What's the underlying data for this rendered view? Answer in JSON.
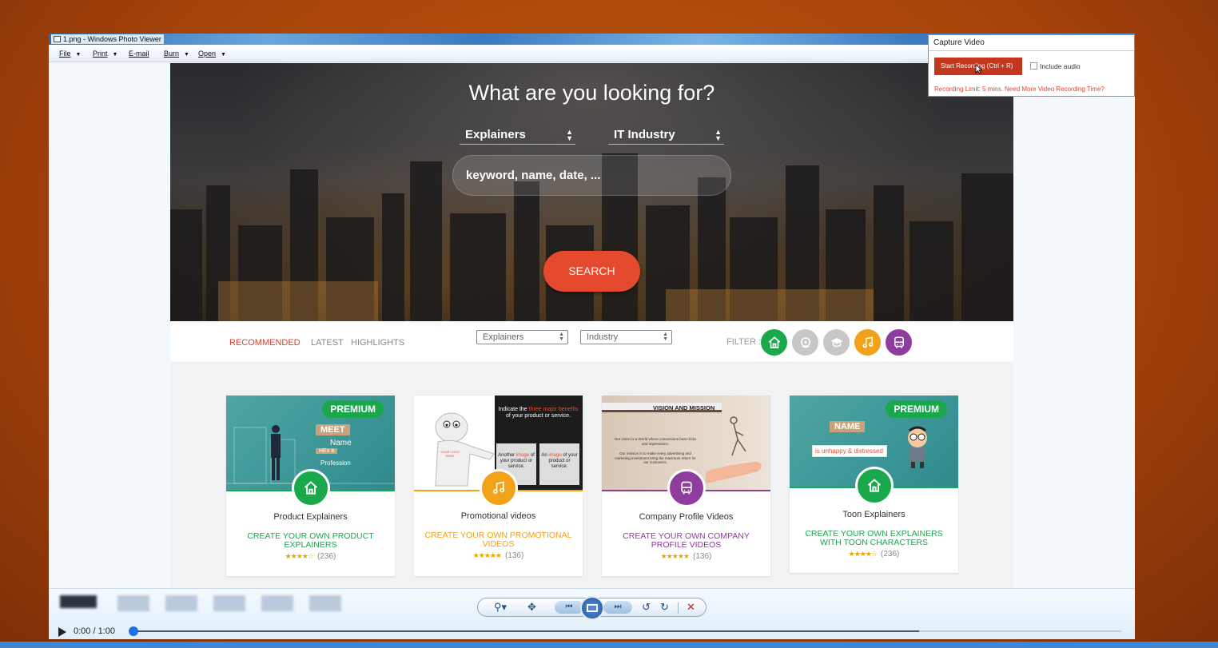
{
  "window": {
    "title": "1.png - Windows Photo Viewer"
  },
  "menu": {
    "file": "File",
    "print": "Print",
    "email": "E-mail",
    "burn": "Burn",
    "open": "Open"
  },
  "hero": {
    "title": "What are you looking for?",
    "select1": "Explainers",
    "select2": "IT Industry",
    "search_placeholder": "keyword, name, date, ...",
    "search_button": "SEARCH"
  },
  "filter": {
    "tabs": [
      "RECOMMENDED",
      "LATEST",
      "HIGHLIGHTS"
    ],
    "select1": "Explainers",
    "select2": "Industry",
    "label": "FILTER :",
    "icon_colors": {
      "home": "#1aa84c",
      "video": "#c7c7c7",
      "education": "#c7c7c7",
      "music": "#f2a218",
      "bus": "#8e3d9e"
    }
  },
  "cards": [
    {
      "title": "Product Explainers",
      "cta": "CREATE YOUR OWN PRODUCT EXPLAINERS",
      "cta_color": "#1aa84c",
      "reviews": "(236)",
      "stars": 4,
      "badge": "PREMIUM",
      "thumb": {
        "meet": "MEET",
        "name": "Name",
        "hex": "HEx a",
        "profession": "Profession"
      }
    },
    {
      "title": "Promotional videos",
      "cta": "CREATE YOUR OWN PROMOTIONAL VIDEOS",
      "cta_color": "#f2a218",
      "reviews": "(136)",
      "stars": 5,
      "badge": "",
      "thumb": {
        "indicate_prefix": "Indicate the ",
        "indicate_hl": "three major benefits",
        "indicate_suffix": " of your product or service.",
        "logo": "YOUR LOGO HERE",
        "another_pre": "Another ",
        "another_hl": "image",
        "another_post": " of your product or service.",
        "an_pre": "An ",
        "an_hl": "image",
        "an_post": " of your product or service."
      }
    },
    {
      "title": "Company Profile Videos",
      "cta": "CREATE YOUR OWN COMPANY PROFILE VIDEOS",
      "cta_color": "#8e3d9e",
      "reviews": "(136)",
      "stars": 5,
      "badge": "",
      "thumb": {
        "heading": "VISION AND MISSION",
        "vision": "Our vision is a World where conversions beat clicks and impressions.",
        "mission": "Our mission is to make every advertising and marketing investment bring the maximum return for our customers."
      }
    },
    {
      "title": "Toon Explainers",
      "cta": "CREATE YOUR OWN EXPLAINERS WITH TOON CHARACTERS",
      "cta_color": "#1aa84c",
      "reviews": "(236)",
      "stars": 4,
      "badge": "PREMIUM",
      "thumb": {
        "name": "NAME",
        "line": "is unhappy & distressed"
      }
    }
  ],
  "player": {
    "time": "0:00 / 1:00",
    "buffered_fraction": 0.795,
    "position_fraction": 0.0
  },
  "capture": {
    "header": "Capture Video",
    "button": "Start Recording (Ctrl + R)",
    "include_audio": "Include audio",
    "limit": "Recording Limit: 5 mins. Need More Video Recording Time?"
  }
}
